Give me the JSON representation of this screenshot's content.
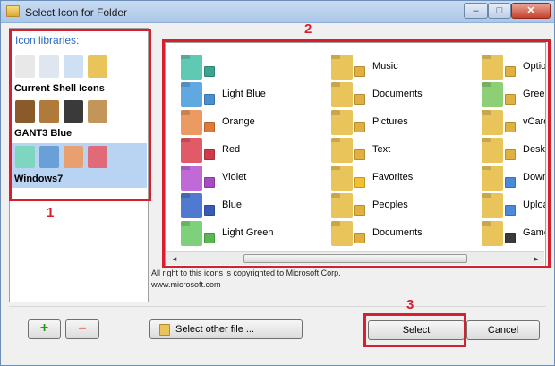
{
  "window": {
    "title": "Select Icon for Folder",
    "controls": {
      "minimize": "–",
      "maximize": "□",
      "close": "✕"
    }
  },
  "libraries": {
    "heading": "Icon libraries:",
    "items": [
      {
        "name": "Current Shell Icons",
        "colors": [
          "#e8e8e8",
          "#dfe6ef",
          "#cfe0f5",
          "#e9c45b"
        ],
        "selected": false
      },
      {
        "name": "GANT3 Blue",
        "colors": [
          "#8a5a2a",
          "#b07a3a",
          "#3a3a3a",
          "#c4955a"
        ],
        "selected": false
      },
      {
        "name": "Windows7",
        "colors": [
          "#7fd6c0",
          "#6aa0d8",
          "#e8a070",
          "#e06a78"
        ],
        "selected": true
      }
    ]
  },
  "icons": {
    "columns": [
      [
        {
          "label": "",
          "folder": "#5fc9b4",
          "badge": "#3aa58f"
        },
        {
          "label": "Light Blue",
          "folder": "#5fa8e0",
          "badge": "#4a90d0"
        },
        {
          "label": "Orange",
          "folder": "#eb9a62",
          "badge": "#e07a3a"
        },
        {
          "label": "Red",
          "folder": "#e05a68",
          "badge": "#d03a48"
        },
        {
          "label": "Violet",
          "folder": "#c06ad8",
          "badge": "#a84ac4"
        },
        {
          "label": "Blue",
          "folder": "#4f7ad0",
          "badge": "#3a5ab8"
        },
        {
          "label": "Light Green",
          "folder": "#7ed07a",
          "badge": "#5ab850"
        }
      ],
      [
        {
          "label": "Music",
          "folder": "#e9c45b",
          "badge": "#e0b040"
        },
        {
          "label": "Documents",
          "folder": "#e9c45b",
          "badge": "#e0b040"
        },
        {
          "label": "Pictures",
          "folder": "#e9c45b",
          "badge": "#e0b040"
        },
        {
          "label": "Text",
          "folder": "#e9c45b",
          "badge": "#e0b040"
        },
        {
          "label": "Favorites",
          "folder": "#e9c45b",
          "badge": "#f0c030"
        },
        {
          "label": "Peoples",
          "folder": "#e9c45b",
          "badge": "#e0b040"
        },
        {
          "label": "Documents",
          "folder": "#e9c45b",
          "badge": "#e0b040"
        }
      ],
      [
        {
          "label": "Optio",
          "folder": "#e9c45b",
          "badge": "#e0b040"
        },
        {
          "label": "Green",
          "folder": "#8ccf74",
          "badge": "#e0b040"
        },
        {
          "label": "vCard",
          "folder": "#e9c45b",
          "badge": "#e0b040"
        },
        {
          "label": "Deskto",
          "folder": "#e9c45b",
          "badge": "#e0b040"
        },
        {
          "label": "Down",
          "folder": "#e9c45b",
          "badge": "#4a8ad8"
        },
        {
          "label": "Uploa",
          "folder": "#e9c45b",
          "badge": "#4a8ad8"
        },
        {
          "label": "Game",
          "folder": "#e9c45b",
          "badge": "#3a3a3a"
        }
      ]
    ]
  },
  "scrollbar": {
    "left_arrow": "◂",
    "right_arrow": "▸"
  },
  "copyright": {
    "line1": "All right to this icons is copyrighted to Microsoft Corp.",
    "line2": "www.microsoft.com"
  },
  "buttons": {
    "add": "+",
    "remove": "–",
    "select_other": "Select other file ...",
    "select": "Select",
    "cancel": "Cancel"
  },
  "callouts": {
    "one": "1",
    "two": "2",
    "three": "3"
  },
  "highlight_color": "#d61f2f"
}
